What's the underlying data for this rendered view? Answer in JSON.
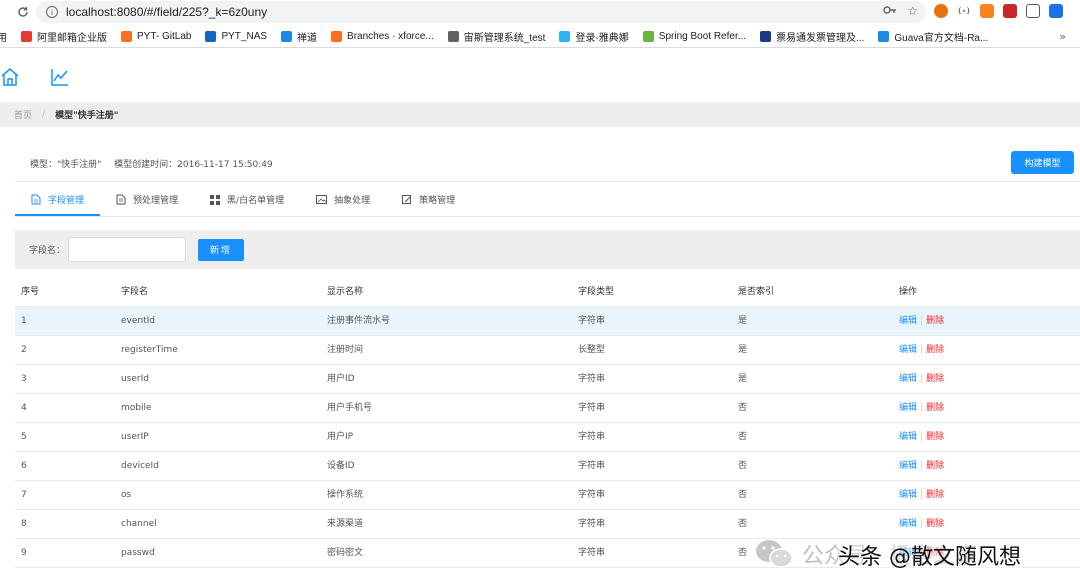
{
  "browser": {
    "url": "localhost:8080/#/field/225?_k=6z0uny",
    "bookmarks": [
      {
        "label": "阿里邮箱企业版",
        "color": "#e53935"
      },
      {
        "label": "PYT- GitLab",
        "color": "#fc6d26"
      },
      {
        "label": "PYT_NAS",
        "color": "#1565c0"
      },
      {
        "label": "禅道",
        "color": "#1e88e5"
      },
      {
        "label": "Branches · xforce...",
        "color": "#fc6d26"
      },
      {
        "label": "宙斯管理系统_test",
        "color": "#5f6368"
      },
      {
        "label": "登录-雅典娜",
        "color": "#29b6f6"
      },
      {
        "label": "Spring Boot Refer...",
        "color": "#6db33f"
      },
      {
        "label": "票易通发票管理及...",
        "color": "#1a3a8a"
      },
      {
        "label": "Guava官方文档-Ra...",
        "color": "#1e88e5"
      }
    ],
    "more": "»"
  },
  "app": {
    "nav_icons": [
      "home-icon",
      "line-chart-icon"
    ]
  },
  "breadcrumb": {
    "home": "首页",
    "current": "模型\"快手注册\""
  },
  "model": {
    "name_label": "模型：\"快手注册\"",
    "created_label": "模型创建时间：2016-11-17 15:50:49",
    "build_button": "构建模型"
  },
  "tabs": [
    {
      "label": "字段管理",
      "icon": "document-icon",
      "active": true
    },
    {
      "label": "预处理管理",
      "icon": "file-icon",
      "active": false
    },
    {
      "label": "黑/白名单管理",
      "icon": "grid-icon",
      "active": false
    },
    {
      "label": "抽象处理",
      "icon": "image-icon",
      "active": false
    },
    {
      "label": "策略管理",
      "icon": "edit-icon",
      "active": false
    }
  ],
  "filter": {
    "label": "字段名：",
    "value": "",
    "add_button": "新增"
  },
  "table": {
    "headers": [
      "序号",
      "字段名",
      "显示名称",
      "字段类型",
      "是否索引",
      "操作"
    ],
    "edit_label": "编辑",
    "delete_label": "删除",
    "op_sep": "|",
    "rows": [
      [
        "1",
        "eventId",
        "注册事件流水号",
        "字符串",
        "是"
      ],
      [
        "2",
        "registerTime",
        "注册时间",
        "长整型",
        "是"
      ],
      [
        "3",
        "userId",
        "用户ID",
        "字符串",
        "是"
      ],
      [
        "4",
        "mobile",
        "用户手机号",
        "字符串",
        "否"
      ],
      [
        "5",
        "userIP",
        "用户IP",
        "字符串",
        "否"
      ],
      [
        "6",
        "deviceId",
        "设备ID",
        "字符串",
        "否"
      ],
      [
        "7",
        "os",
        "操作系统",
        "字符串",
        "否"
      ],
      [
        "8",
        "channel",
        "来源渠道",
        "字符串",
        "否"
      ],
      [
        "9",
        "passwd",
        "密码密文",
        "字符串",
        "否"
      ]
    ],
    "highlighted_row": 0
  },
  "watermark": {
    "line1": "公众号 · 极客之家",
    "line2": "头条 @散文随风想"
  }
}
